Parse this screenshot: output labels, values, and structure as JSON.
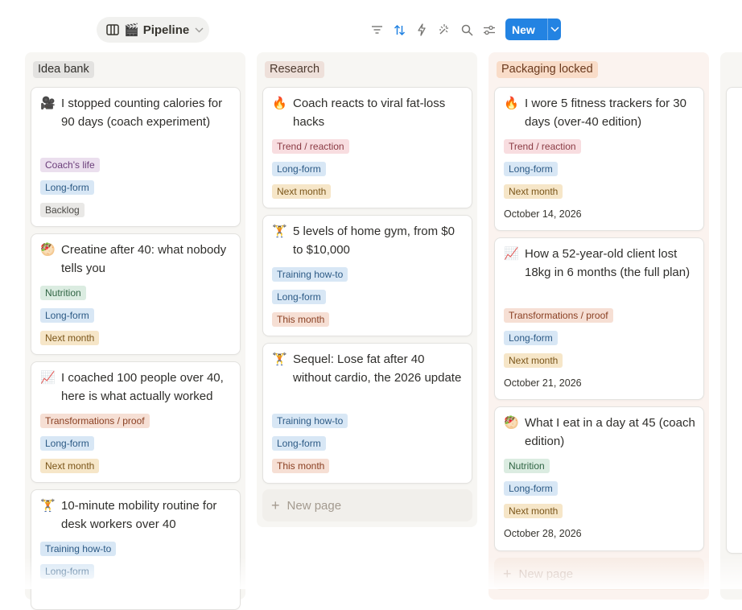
{
  "view": {
    "icon": "columns-icon",
    "emoji": "🎬",
    "name": "Pipeline"
  },
  "toolbar": {
    "tools": [
      "filter-icon",
      "sort-icon",
      "lightning-icon",
      "sparkle-icon",
      "search-icon",
      "settings-sliders-icon"
    ],
    "new_label": "New"
  },
  "colors": {
    "accent": "#2383e2",
    "column_idea": "#f7f6f3",
    "column_research": "#f7f6f3",
    "column_packaging": "#fbf3ef"
  },
  "columns": [
    {
      "name": "Idea bank",
      "cards": [
        {
          "emoji": "🎥",
          "title": "I stopped counting calories for 90 days (coach experiment)",
          "tags": [
            "Coach's life",
            "Long-form",
            "Backlog"
          ]
        },
        {
          "emoji": "🥙",
          "title": "Creatine after 40: what nobody tells you",
          "tags": [
            "Nutrition",
            "Long-form",
            "Next month"
          ]
        },
        {
          "emoji": "📈",
          "title": "I coached 100 people over 40, here is what actually worked",
          "tags": [
            "Transformations / proof",
            "Long-form",
            "Next month"
          ]
        },
        {
          "emoji": "🏋️",
          "title": "10-minute mobility routine for desk workers over 40",
          "tags": [
            "Training how-to",
            "Long-form"
          ]
        }
      ]
    },
    {
      "name": "Research",
      "cards": [
        {
          "emoji": "🔥",
          "title": "Coach reacts to viral fat-loss hacks",
          "tags": [
            "Trend / reaction",
            "Long-form",
            "Next month"
          ]
        },
        {
          "emoji": "🏋️",
          "title": "5 levels of home gym, from $0 to $10,000",
          "tags": [
            "Training how-to",
            "Long-form",
            "This month"
          ]
        },
        {
          "emoji": "🏋️",
          "title": "Sequel: Lose fat after 40 without cardio, the 2026 update",
          "tags": [
            "Training how-to",
            "Long-form",
            "This month"
          ]
        }
      ],
      "new_page": "New page"
    },
    {
      "name": "Packaging locked",
      "cards": [
        {
          "emoji": "🔥",
          "title": "I wore 5 fitness trackers for 30 days (over-40 edition)",
          "tags": [
            "Trend / reaction",
            "Long-form",
            "Next month"
          ],
          "date": "October 14, 2026"
        },
        {
          "emoji": "📈",
          "title": "How a 52-year-old client lost 18kg in 6 months (the full plan)",
          "tags": [
            "Transformations / proof",
            "Long-form",
            "Next month"
          ],
          "date": "October 21, 2026"
        },
        {
          "emoji": "🥙",
          "title": "What I eat in a day at 45 (coach edition)",
          "tags": [
            "Nutrition",
            "Long-form",
            "Next month"
          ],
          "date": "October 28, 2026"
        }
      ],
      "new_page": "New page"
    }
  ]
}
